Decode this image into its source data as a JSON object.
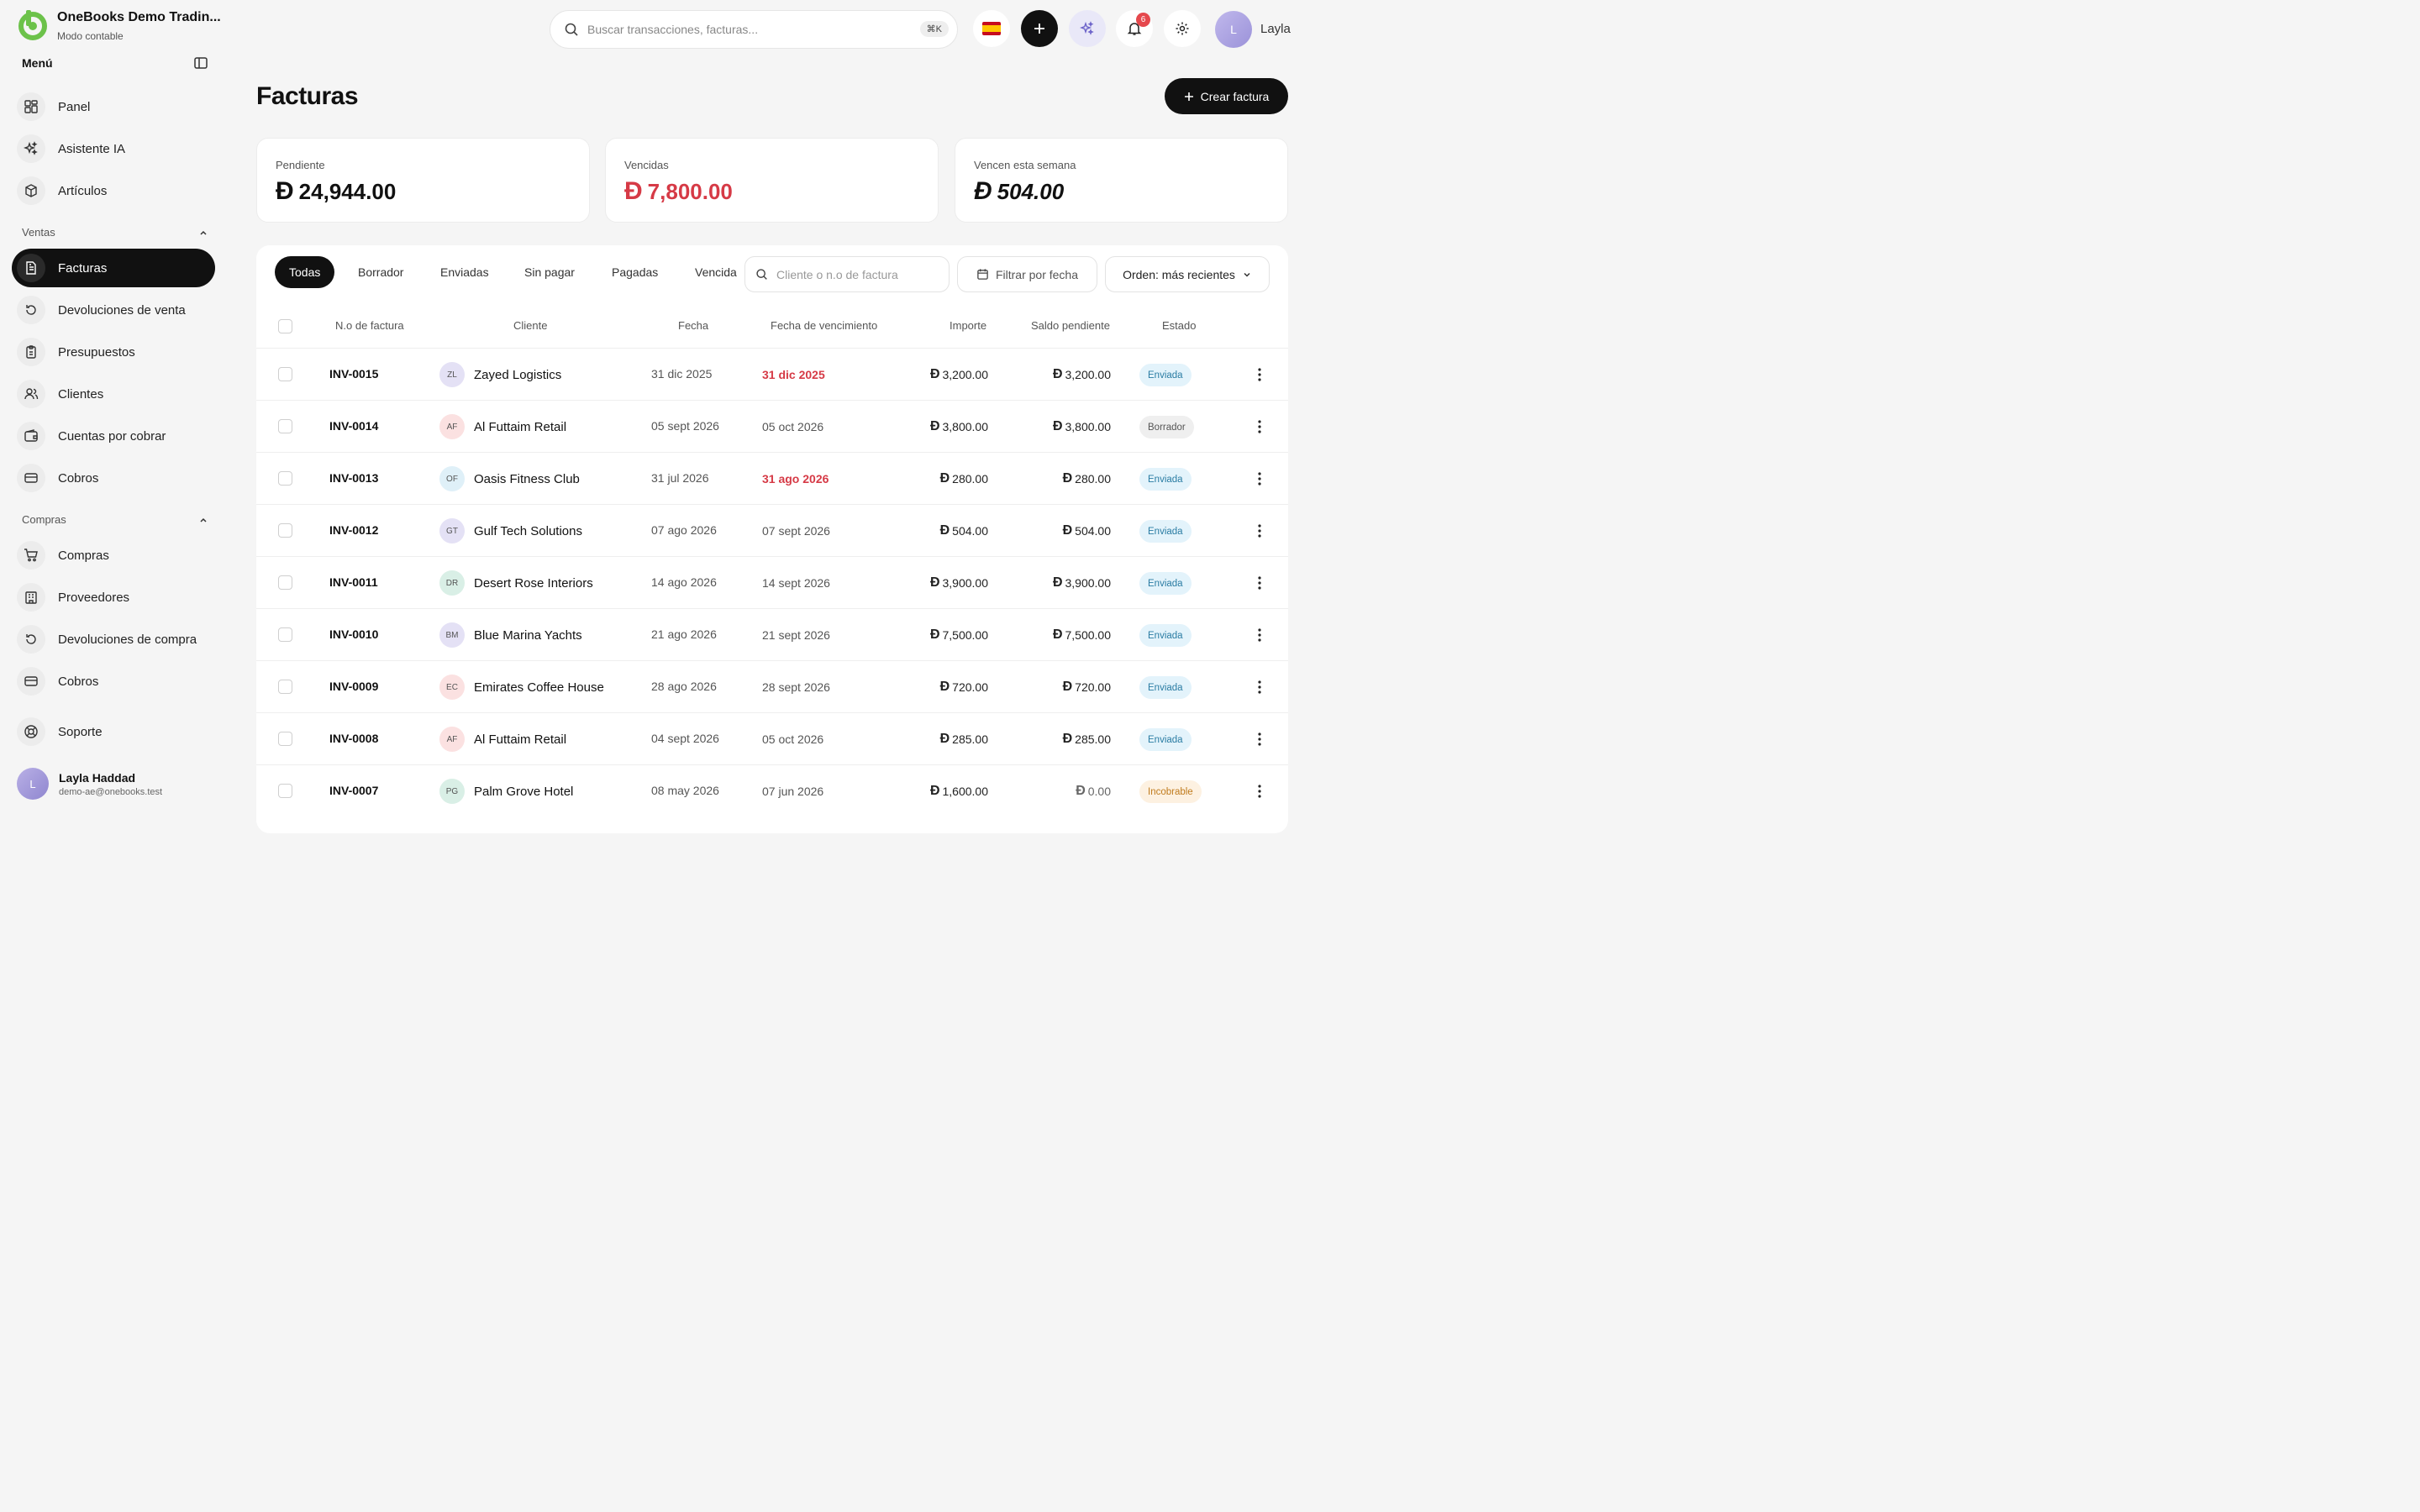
{
  "brand": {
    "title": "OneBooks Demo Tradin...",
    "subtitle": "Modo contable"
  },
  "sidebar": {
    "menu_label": "Menú",
    "top_items": [
      {
        "label": "Panel"
      },
      {
        "label": "Asistente IA"
      },
      {
        "label": "Artículos"
      }
    ],
    "sections": [
      {
        "title": "Ventas",
        "items": [
          {
            "label": "Facturas"
          },
          {
            "label": "Devoluciones de venta"
          },
          {
            "label": "Presupuestos"
          },
          {
            "label": "Clientes"
          },
          {
            "label": "Cuentas por cobrar"
          },
          {
            "label": "Cobros"
          }
        ]
      },
      {
        "title": "Compras",
        "items": [
          {
            "label": "Compras"
          },
          {
            "label": "Proveedores"
          },
          {
            "label": "Devoluciones de compra"
          },
          {
            "label": "Cobros"
          }
        ]
      }
    ],
    "support_label": "Soporte",
    "user": {
      "initial": "L",
      "name": "Layla Haddad",
      "email": "demo-ae@onebooks.test"
    }
  },
  "header": {
    "search_placeholder": "Buscar transacciones, facturas...",
    "search_shortcut": "⌘K",
    "notification_count": "6",
    "user_initial": "L",
    "user_name": "Layla"
  },
  "page": {
    "title": "Facturas",
    "create_button": "Crear factura"
  },
  "currency_symbol": "Ð",
  "stats": [
    {
      "label": "Pendiente",
      "value": "24,944.00",
      "color": "#111111"
    },
    {
      "label": "Vencidas",
      "value": "7,800.00",
      "color": "#d63a46"
    },
    {
      "label": "Vencen esta semana",
      "value": "504.00",
      "color": "#111111"
    }
  ],
  "tabs": [
    "Todas",
    "Borrador",
    "Enviadas",
    "Sin pagar",
    "Pagadas",
    "Vencida"
  ],
  "filters": {
    "search_placeholder": "Cliente o n.o de factura",
    "date_filter": "Filtrar por fecha",
    "sort": "Orden: más recientes"
  },
  "table": {
    "headers": {
      "number": "N.o de factura",
      "client": "Cliente",
      "date": "Fecha",
      "due": "Fecha de vencimiento",
      "amount": "Importe",
      "balance": "Saldo pendiente",
      "status": "Estado"
    },
    "rows": [
      {
        "number": "INV-0015",
        "initials": "ZL",
        "avatar_bg": "#e4e1f5",
        "client": "Zayed Logistics",
        "date": "31 dic 2025",
        "due": "31 dic 2025",
        "due_overdue": true,
        "amount": "3,200.00",
        "balance": "3,200.00",
        "status": "Enviada",
        "status_kind": "enviada"
      },
      {
        "number": "INV-0014",
        "initials": "AF",
        "avatar_bg": "#fbe1e1",
        "client": "Al Futtaim Retail",
        "date": "05 sept 2026",
        "due": "05 oct 2026",
        "due_overdue": false,
        "amount": "3,800.00",
        "balance": "3,800.00",
        "status": "Borrador",
        "status_kind": "borrador"
      },
      {
        "number": "INV-0013",
        "initials": "OF",
        "avatar_bg": "#dff0f8",
        "client": "Oasis Fitness Club",
        "date": "31 jul 2026",
        "due": "31 ago 2026",
        "due_overdue": true,
        "amount": "280.00",
        "balance": "280.00",
        "status": "Enviada",
        "status_kind": "enviada"
      },
      {
        "number": "INV-0012",
        "initials": "GT",
        "avatar_bg": "#e4e1f5",
        "client": "Gulf Tech Solutions",
        "date": "07 ago 2026",
        "due": "07 sept 2026",
        "due_overdue": false,
        "amount": "504.00",
        "balance": "504.00",
        "status": "Enviada",
        "status_kind": "enviada"
      },
      {
        "number": "INV-0011",
        "initials": "DR",
        "avatar_bg": "#d9efe6",
        "client": "Desert Rose Interiors",
        "date": "14 ago 2026",
        "due": "14 sept 2026",
        "due_overdue": false,
        "amount": "3,900.00",
        "balance": "3,900.00",
        "status": "Enviada",
        "status_kind": "enviada"
      },
      {
        "number": "INV-0010",
        "initials": "BM",
        "avatar_bg": "#e4e1f5",
        "client": "Blue Marina Yachts",
        "date": "21 ago 2026",
        "due": "21 sept 2026",
        "due_overdue": false,
        "amount": "7,500.00",
        "balance": "7,500.00",
        "status": "Enviada",
        "status_kind": "enviada"
      },
      {
        "number": "INV-0009",
        "initials": "EC",
        "avatar_bg": "#fbe1e1",
        "client": "Emirates Coffee House",
        "date": "28 ago 2026",
        "due": "28 sept 2026",
        "due_overdue": false,
        "amount": "720.00",
        "balance": "720.00",
        "status": "Enviada",
        "status_kind": "enviada"
      },
      {
        "number": "INV-0008",
        "initials": "AF",
        "avatar_bg": "#fbe1e1",
        "client": "Al Futtaim Retail",
        "date": "04 sept 2026",
        "due": "05 oct 2026",
        "due_overdue": false,
        "amount": "285.00",
        "balance": "285.00",
        "status": "Enviada",
        "status_kind": "enviada"
      },
      {
        "number": "INV-0007",
        "initials": "PG",
        "avatar_bg": "#d9efe6",
        "client": "Palm Grove Hotel",
        "date": "08 may 2026",
        "due": "07 jun 2026",
        "due_overdue": false,
        "amount": "1,600.00",
        "balance": "0.00",
        "status": "Incobrable",
        "status_kind": "incobrable"
      }
    ]
  },
  "icons": {
    "brand": "onebooks-logo",
    "search": "search-icon",
    "flag": "spain-flag-icon",
    "add": "plus-icon",
    "ai": "sparkles-icon",
    "bell": "bell-icon",
    "settings": "gear-icon",
    "calendar": "calendar-icon",
    "chevron": "chevron-down-icon",
    "kebab": "kebab-menu-icon"
  },
  "colors": {
    "accent": "#111111",
    "brand_green": "#6cc24a",
    "overdue_red": "#d63a46",
    "ai_tint": "#e9e8f8"
  }
}
